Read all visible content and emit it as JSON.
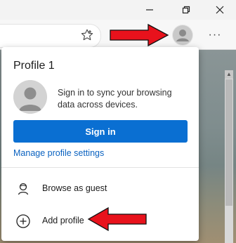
{
  "window": {
    "controls": [
      "minimize-icon",
      "restore-icon",
      "close-icon"
    ]
  },
  "toolbar": {
    "favorite_icon": "star-icon",
    "profile_icon": "avatar-icon",
    "more_label": "···"
  },
  "flyout": {
    "title": "Profile 1",
    "sync_text": "Sign in to sync your browsing data across devices.",
    "signin_label": "Sign in",
    "manage_link": "Manage profile settings",
    "items": [
      {
        "label": "Browse as guest",
        "icon": "guest-icon"
      },
      {
        "label": "Add profile",
        "icon": "add-circle-icon"
      }
    ]
  },
  "colors": {
    "accent": "#0a6fd2",
    "link": "#0a62c0",
    "annotation": "#e8121c"
  }
}
